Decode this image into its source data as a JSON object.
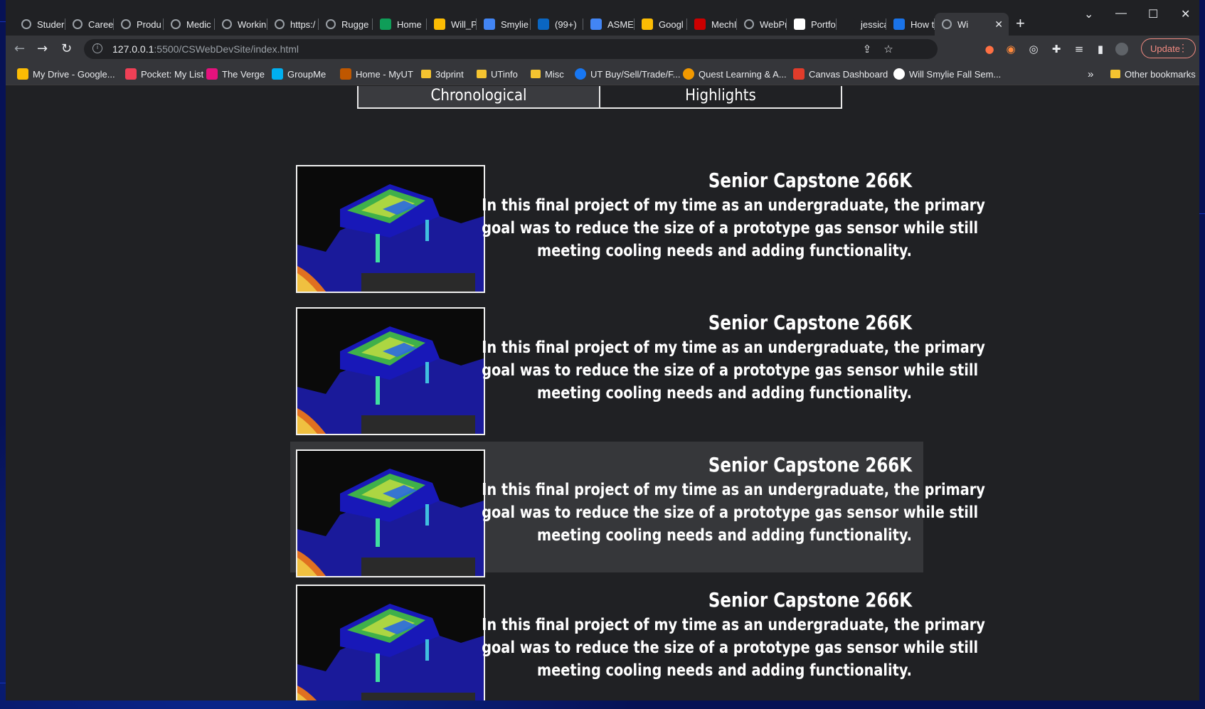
{
  "tabs": [
    {
      "label": "Studer",
      "icon": "globe-icon",
      "color": "#9aa0a6"
    },
    {
      "label": "Careers",
      "icon": "globe-icon",
      "color": "#9aa0a6"
    },
    {
      "label": "Produ",
      "icon": "globe-icon",
      "color": "#9aa0a6"
    },
    {
      "label": "Medic",
      "icon": "globe-icon",
      "color": "#9aa0a6"
    },
    {
      "label": "Workin",
      "icon": "globe-icon",
      "color": "#9aa0a6"
    },
    {
      "label": "https:/",
      "icon": "globe-icon",
      "color": "#9aa0a6"
    },
    {
      "label": "Rugge",
      "icon": "globe-icon",
      "color": "#9aa0a6"
    },
    {
      "label": "Home",
      "icon": "sheets-icon",
      "color": "#0f9d58"
    },
    {
      "label": "Will_P",
      "icon": "drive-icon",
      "color": "#fbbc04"
    },
    {
      "label": "Smylie",
      "icon": "docs-icon",
      "color": "#4285f4"
    },
    {
      "label": "(99+)",
      "icon": "linkedin-icon",
      "color": "#0a66c2"
    },
    {
      "label": "ASME",
      "icon": "docs-icon",
      "color": "#4285f4"
    },
    {
      "label": "Googl",
      "icon": "keep-icon",
      "color": "#fbbc04"
    },
    {
      "label": "MechI",
      "icon": "bu-icon",
      "color": "#cc0000"
    },
    {
      "label": "WebPr",
      "icon": "globe-icon",
      "color": "#9aa0a6"
    },
    {
      "label": "Portfo",
      "icon": "portfolio-icon",
      "color": "#ffffff"
    },
    {
      "label": "jessica",
      "icon": "blank-icon",
      "color": "#202124"
    },
    {
      "label": "How t",
      "icon": "info-icon",
      "color": "#1a73e8"
    },
    {
      "label": "Wi",
      "icon": "globe-icon",
      "color": "#9aa0a6"
    }
  ],
  "url": {
    "host": "127.0.0.1",
    "path": ":5500/CSWebDevSite/index.html"
  },
  "update_label": "Update",
  "bookmarks": [
    {
      "label": "My Drive - Google...",
      "type": "drive",
      "color": "#fbbc04"
    },
    {
      "label": "Pocket: My List",
      "type": "pocket",
      "color": "#ef4056"
    },
    {
      "label": "The Verge",
      "type": "verge",
      "color": "#e5127d"
    },
    {
      "label": "GroupMe",
      "type": "groupme",
      "color": "#00aff0"
    },
    {
      "label": "Home - MyUT",
      "type": "ut",
      "color": "#bf5700"
    },
    {
      "label": "3dprint",
      "type": "folder",
      "color": "#f5c430"
    },
    {
      "label": "UTinfo",
      "type": "folder",
      "color": "#f5c430"
    },
    {
      "label": "Misc",
      "type": "folder",
      "color": "#f5c430"
    },
    {
      "label": "UT Buy/Sell/Trade/F...",
      "type": "facebook",
      "color": "#1877f2"
    },
    {
      "label": "Quest Learning & A...",
      "type": "quest",
      "color": "#f29900"
    },
    {
      "label": "Canvas Dashboard",
      "type": "canvas",
      "color": "#e23c2b"
    },
    {
      "label": "Will Smylie Fall Sem...",
      "type": "google",
      "color": "#ffffff"
    }
  ],
  "bookmarks_overflow": "»",
  "other_bookmarks": "Other bookmarks",
  "toggle": {
    "option_a": "Chronological",
    "option_b": "Highlights"
  },
  "projects": [
    {
      "title": "Senior Capstone 266K",
      "desc": [
        "In this final project of my time as an undergraduate, the primary",
        "goal was to reduce the size of a prototype gas sensor while still",
        "meeting cooling needs and adding functionality."
      ]
    },
    {
      "title": "Senior Capstone 266K",
      "desc": [
        "In this final project of my time as an undergraduate, the primary",
        "goal was to reduce the size of a prototype gas sensor while still",
        "meeting cooling needs and adding functionality."
      ]
    },
    {
      "title": "Senior Capstone 266K",
      "desc": [
        "In this final project of my time as an undergraduate, the primary",
        "goal was to reduce the size of a prototype gas sensor while still",
        "meeting cooling needs and adding functionality."
      ]
    },
    {
      "title": "Senior Capstone 266K",
      "desc": [
        "In this final project of my time as an undergraduate, the primary",
        "goal was to reduce the size of a prototype gas sensor while still",
        "meeting cooling needs and adding functionality."
      ]
    }
  ]
}
